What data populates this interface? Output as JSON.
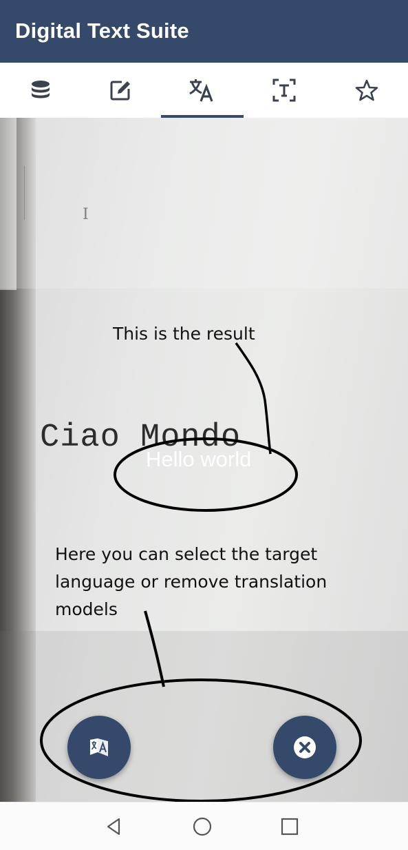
{
  "app": {
    "title": "Digital Text Suite"
  },
  "tabs": [
    {
      "id": "database",
      "icon": "database-icon"
    },
    {
      "id": "edit",
      "icon": "edit-icon"
    },
    {
      "id": "translate",
      "icon": "translate-icon",
      "selected": true
    },
    {
      "id": "text-scan",
      "icon": "text-scan-icon"
    },
    {
      "id": "favorites",
      "icon": "star-icon"
    }
  ],
  "camera": {
    "source_text": "Ciao Mondo",
    "translated_text": "Hello world"
  },
  "annotations": {
    "result_note": "This is the result",
    "help_note_line1": "Here you can select the target",
    "help_note_line2": "language or remove translation",
    "help_note_line3": "models"
  },
  "actions": {
    "select_language": {
      "icon": "language-translate-icon"
    },
    "remove_models": {
      "icon": "close-circle-icon"
    }
  },
  "navigation": [
    {
      "id": "back",
      "icon": "back-triangle-icon"
    },
    {
      "id": "home",
      "icon": "home-circle-icon"
    },
    {
      "id": "recents",
      "icon": "recents-square-icon"
    }
  ],
  "colors": {
    "primary": "#354a6b",
    "tab_icon": "#3a4250",
    "white": "#ffffff"
  }
}
